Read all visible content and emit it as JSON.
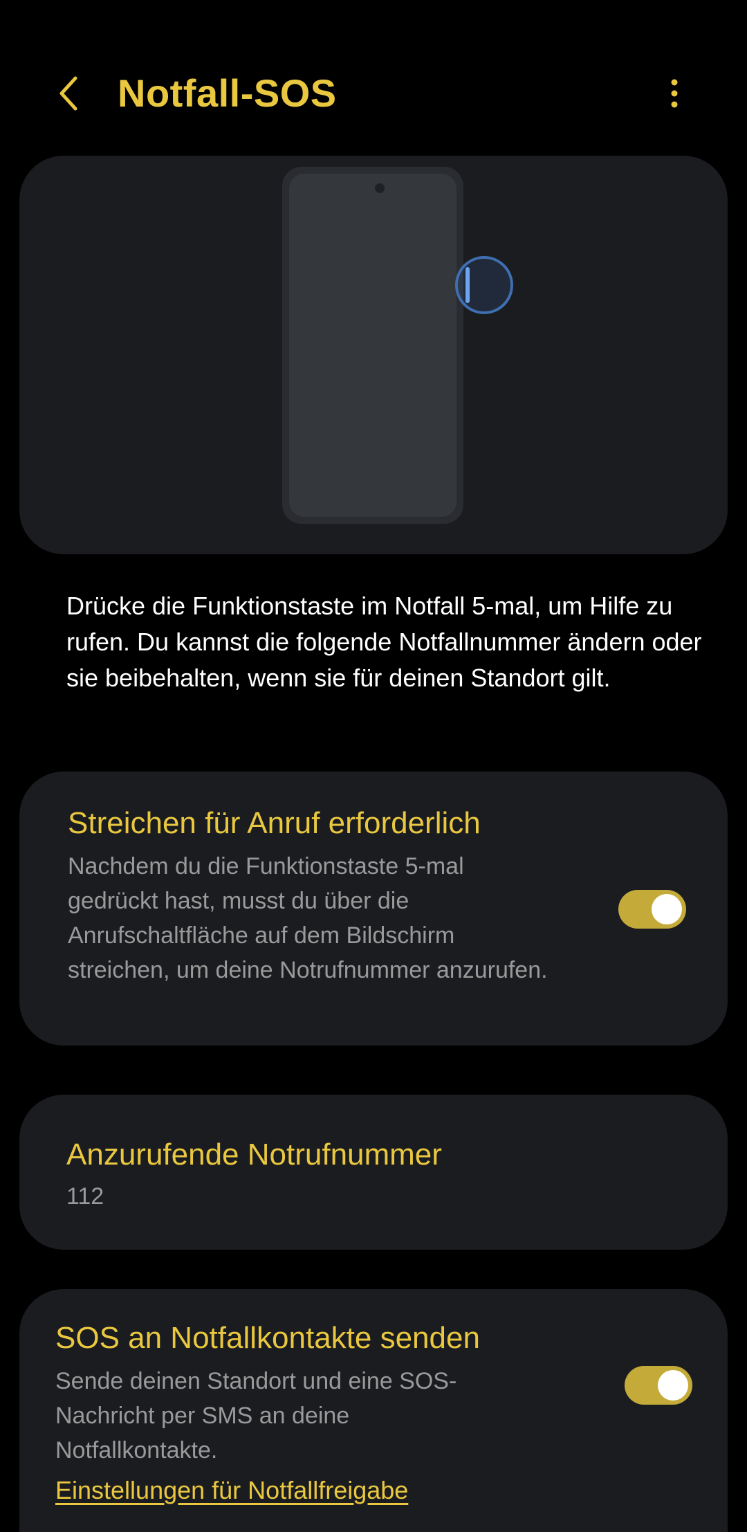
{
  "header": {
    "title": "Notfall-SOS",
    "back_icon": "chevron-left-icon",
    "more_icon": "more-vertical-icon"
  },
  "colors": {
    "accent": "#E9C840",
    "background": "#000000",
    "card": "#1B1C20",
    "toggle_on": "#C4AB39",
    "press_indicator": "#3F6FB0"
  },
  "description": "Drücke die Funktionstaste im Notfall 5-mal, um Hilfe zu rufen. Du kannst die folgende Notfallnummer ändern oder sie beibehalten, wenn sie für deinen Standort gilt.",
  "settings": {
    "swipe_to_call": {
      "title": "Streichen für Anruf erforderlich",
      "subtitle": "Nachdem du die Funktionstaste 5-mal gedrückt hast, musst du über die Anrufschaltfläche auf dem Bildschirm streichen, um deine Notrufnummer anzurufen.",
      "enabled": true
    },
    "emergency_number": {
      "title": "Anzurufende Notrufnummer",
      "value": "112"
    },
    "send_sos": {
      "title": "SOS an Notfallkontakte senden",
      "subtitle": "Sende deinen Standort und eine SOS-Nachricht per SMS an deine Notfallkontakte.",
      "link": "Einstellungen für Notfallfreigabe",
      "enabled": true
    }
  }
}
